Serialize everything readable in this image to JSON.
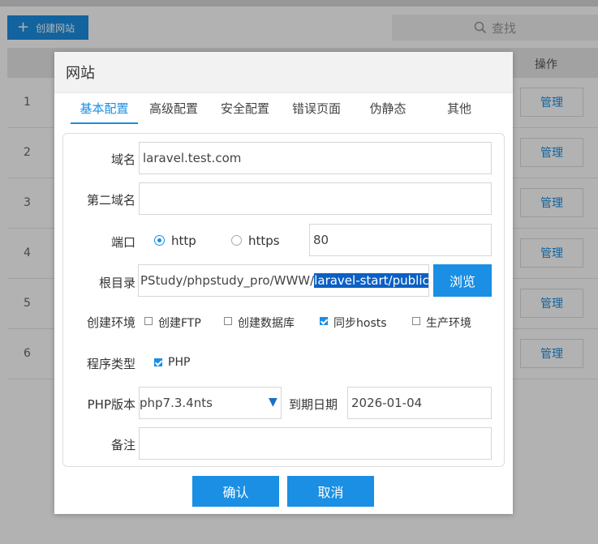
{
  "toolbar": {
    "create_label": "创建网站",
    "search_placeholder": "查找"
  },
  "table": {
    "op_header": "操作",
    "rows": [
      {
        "num": "1",
        "action": "管理"
      },
      {
        "num": "2",
        "action": "管理"
      },
      {
        "num": "3",
        "action": "管理"
      },
      {
        "num": "4",
        "action": "管理"
      },
      {
        "num": "5",
        "action": "管理"
      },
      {
        "num": "6",
        "action": "管理"
      }
    ]
  },
  "dialog": {
    "title": "网站",
    "tabs": [
      "基本配置",
      "高级配置",
      "安全配置",
      "错误页面",
      "伪静态",
      "其他"
    ],
    "active_tab": "基本配置",
    "form": {
      "domain_label": "域名",
      "domain_value": "laravel.test.com",
      "second_domain_label": "第二域名",
      "second_domain_value": "",
      "port_label": "端口",
      "http_label": "http",
      "https_label": "https",
      "port_value": "80",
      "selected_protocol": "http",
      "root_label": "根目录",
      "root_value_prefix": "PStudy/phpstudy_pro/WWW/",
      "root_value_selected": "laravel-start/public",
      "browse_label": "浏览",
      "env_label": "创建环境",
      "env_options": [
        {
          "label": "创建FTP",
          "checked": false
        },
        {
          "label": "创建数据库",
          "checked": false
        },
        {
          "label": "同步hosts",
          "checked": true
        },
        {
          "label": "生产环境",
          "checked": false
        }
      ],
      "program_type_label": "程序类型",
      "program_type_option": "PHP",
      "program_type_checked": true,
      "php_version_label": "PHP版本",
      "php_version_value": "php7.3.4nts",
      "expire_label": "到期日期",
      "expire_value": "2026-01-04",
      "remark_label": "备注",
      "remark_value": ""
    },
    "confirm_label": "确认",
    "cancel_label": "取消"
  },
  "colors": {
    "accent": "#1a8fe3",
    "selection": "#0a60c4"
  }
}
